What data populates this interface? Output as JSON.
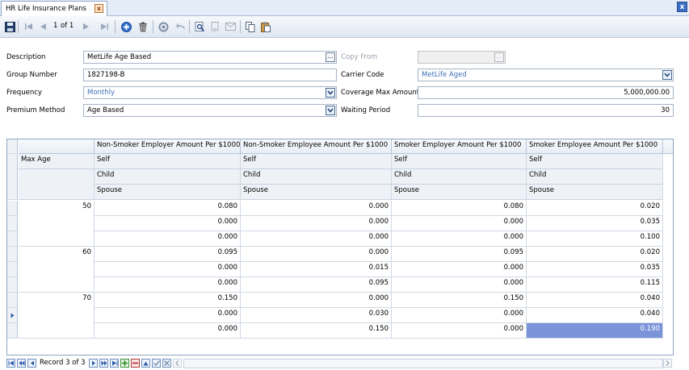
{
  "window": {
    "tab_title": "HR Life Insurance Plans",
    "tab_close_glyph": "x",
    "close_glyph": "x"
  },
  "toolbar": {
    "page_current": "1",
    "page_of": "of 1",
    "icons": [
      "save-icon",
      "first-record-icon",
      "previous-record-icon",
      "next-record-icon",
      "last-record-icon",
      "add-icon",
      "delete-icon",
      "refresh-icon",
      "undo-icon",
      "find-icon",
      "report-icon",
      "email-icon",
      "copy-icon",
      "paste-icon"
    ]
  },
  "form": {
    "description": {
      "label": "Description",
      "value": "MetLife Age Based"
    },
    "copy_from": {
      "label": "Copy From",
      "value": ""
    },
    "group_number": {
      "label": "Group Number",
      "value": "1827198-B"
    },
    "carrier_code": {
      "label": "Carrier Code",
      "value": "MetLife Aged"
    },
    "frequency": {
      "label": "Frequency",
      "value": "Monthly"
    },
    "coverage_max_amount": {
      "label": "Coverage Max Amount",
      "value": "5,000,000.00"
    },
    "premium_method": {
      "label": "Premium Method",
      "value": "Age Based"
    },
    "waiting_period": {
      "label": "Waiting Period",
      "value": "30"
    },
    "ellipsis_glyph": "..."
  },
  "grid": {
    "first_col_header": "Max Age",
    "columns": [
      "Non-Smoker Employer Amount Per $1000",
      "Non-Smoker Employee Amount Per $1000",
      "Smoker Employer Amount Per $1000",
      "Smoker Employee Amount Per $1000"
    ],
    "sub_rows": [
      "Self",
      "Child",
      "Spouse"
    ],
    "groups": [
      {
        "max_age": "50",
        "rows": [
          [
            "0.080",
            "0.000",
            "0.080",
            "0.020"
          ],
          [
            "0.000",
            "0.000",
            "0.000",
            "0.035"
          ],
          [
            "0.000",
            "0.000",
            "0.000",
            "0.100"
          ]
        ]
      },
      {
        "max_age": "60",
        "rows": [
          [
            "0.095",
            "0.000",
            "0.095",
            "0.020"
          ],
          [
            "0.000",
            "0.015",
            "0.000",
            "0.035"
          ],
          [
            "0.000",
            "0.095",
            "0.000",
            "0.115"
          ]
        ]
      },
      {
        "max_age": "70",
        "rows": [
          [
            "0.150",
            "0.000",
            "0.150",
            "0.040"
          ],
          [
            "0.000",
            "0.030",
            "0.000",
            "0.040"
          ],
          [
            "0.000",
            "0.150",
            "0.000",
            "0.190"
          ]
        ]
      }
    ],
    "selected_cell": {
      "group": 2,
      "row": 2,
      "col": 3
    }
  },
  "navigator": {
    "record_text": "Record 3 of 3"
  },
  "colors": {
    "accent": "#3a6fc4",
    "selected_cell": "#7a93d9",
    "field_blue_text": "#3f6fb5"
  }
}
